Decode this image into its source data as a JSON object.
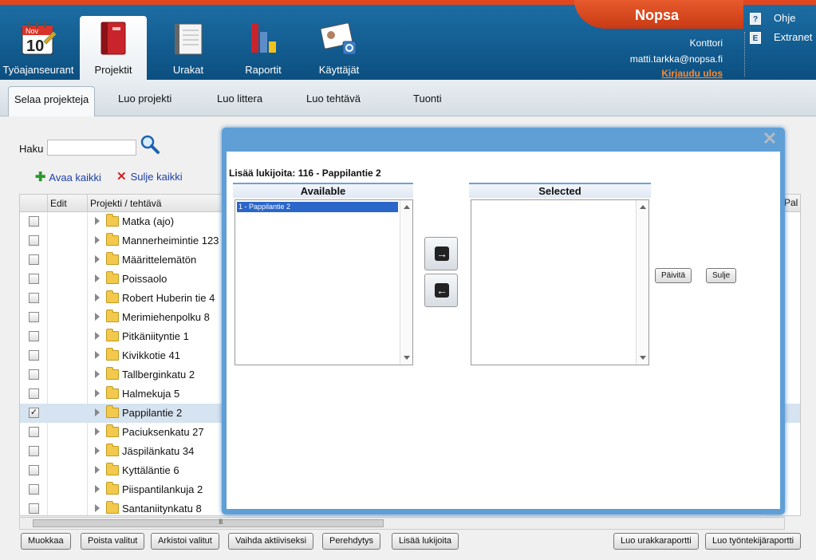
{
  "header": {
    "brand": "Nopsa",
    "apps": [
      {
        "label": "Työajanseurant",
        "icon": "calendar-icon",
        "active": false
      },
      {
        "label": "Projektit",
        "icon": "binder-icon",
        "active": true
      },
      {
        "label": "Urakat",
        "icon": "notebook-icon",
        "active": false
      },
      {
        "label": "Raportit",
        "icon": "bar-chart-icon",
        "active": false
      },
      {
        "label": "Käyttäjät",
        "icon": "id-card-icon",
        "active": false
      }
    ],
    "calendar_month": "Nov",
    "calendar_day": "10",
    "account": {
      "company": "Konttori",
      "email": "matti.tarkka@nopsa.fi",
      "logout": "Kirjaudu ulos"
    },
    "links": [
      {
        "label": "Ohje",
        "icon_text": "?"
      },
      {
        "label": "Extranet",
        "icon_text": "E"
      }
    ]
  },
  "subnav": {
    "tabs": [
      {
        "label": "Selaa projekteja",
        "active": true
      },
      {
        "label": "Luo projekti"
      },
      {
        "label": "Luo littera"
      },
      {
        "label": "Luo tehtävä"
      },
      {
        "label": "Tuonti"
      }
    ]
  },
  "search": {
    "label": "Haku",
    "value": ""
  },
  "toolbar": {
    "expand_all": "Avaa kaikki",
    "collapse_all": "Sulje kaikki"
  },
  "grid": {
    "columns": [
      "Edit",
      "Projekti / tehtävä"
    ],
    "extra_column": "Pal",
    "rows": [
      {
        "label": "Matka (ajo)",
        "checked": false
      },
      {
        "label": "Mannerheimintie 123",
        "checked": false
      },
      {
        "label": "Määrittelemätön",
        "checked": false
      },
      {
        "label": "Poissaolo",
        "checked": false
      },
      {
        "label": "Robert Huberin tie 4",
        "checked": false
      },
      {
        "label": "Merimiehenpolku 8",
        "checked": false
      },
      {
        "label": "Pitkäniityntie 1",
        "checked": false
      },
      {
        "label": "Kivikkotie 41",
        "checked": false
      },
      {
        "label": "Tallberginkatu 2",
        "checked": false
      },
      {
        "label": "Halmekuja 5",
        "checked": false
      },
      {
        "label": "Pappilantie 2",
        "checked": true
      },
      {
        "label": "Paciuksenkatu 27",
        "checked": false
      },
      {
        "label": "Jäspilänkatu 34",
        "checked": false
      },
      {
        "label": "Kyttäläntie 6",
        "checked": false
      },
      {
        "label": "Piispantilankuja 2",
        "checked": false
      },
      {
        "label": "Santaniitynkatu 8",
        "checked": false
      }
    ],
    "hscroll_grip": "III"
  },
  "bottom_buttons": {
    "left": [
      "Muokkaa",
      "Poista valitut",
      "Arkistoi valitut",
      "Vaihda aktiiviseksi",
      "Perehdytys",
      "Lisää lukijoita"
    ],
    "right": [
      "Luo urakkaraportti",
      "Luo työntekijäraportti"
    ]
  },
  "modal": {
    "title": "Lisää lukijoita: 116 - Pappilantie 2",
    "available_label": "Available",
    "selected_label": "Selected",
    "available_items": [
      "1 - Pappilantie 2"
    ],
    "selected_items": [],
    "move_right_glyph": "→",
    "move_left_glyph": "←",
    "update_label": "Päivitä",
    "close_label": "Sulje",
    "close_glyph": "✕"
  }
}
